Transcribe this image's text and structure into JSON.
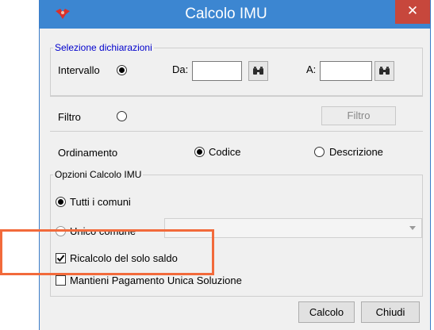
{
  "window": {
    "title": "Calcolo IMU",
    "close_glyph": "✕",
    "titlebar_color": "#3c86d1",
    "close_color": "#c7473c",
    "icon": "red-bird-app-icon"
  },
  "selection_group": {
    "legend": "Selezione dichiarazioni",
    "legend_color": "#0000cc",
    "intervallo_label": "Intervallo",
    "da_label": "Da:",
    "da_value": "",
    "a_label": "A:",
    "a_value": "",
    "search_icon": "binoculars-icon",
    "filtro_label": "Filtro",
    "filtro_button": "Filtro",
    "ordinamento_label": "Ordinamento",
    "codice_label": "Codice",
    "descrizione_label": "Descrizione"
  },
  "options_group": {
    "legend": "Opzioni Calcolo IMU",
    "tutti_label": "Tutti i comuni",
    "unico_label": "Unico comune",
    "unico_value": "",
    "ricalcolo_label": "Ricalcolo del solo saldo",
    "ricalcolo_checked": true,
    "mantieni_label": "Mantieni Pagamento Unica Soluzione",
    "mantieni_checked": false
  },
  "buttons": {
    "calcolo": "Calcolo",
    "chiudi": "Chiudi"
  },
  "highlight_color": "#f26a3b"
}
